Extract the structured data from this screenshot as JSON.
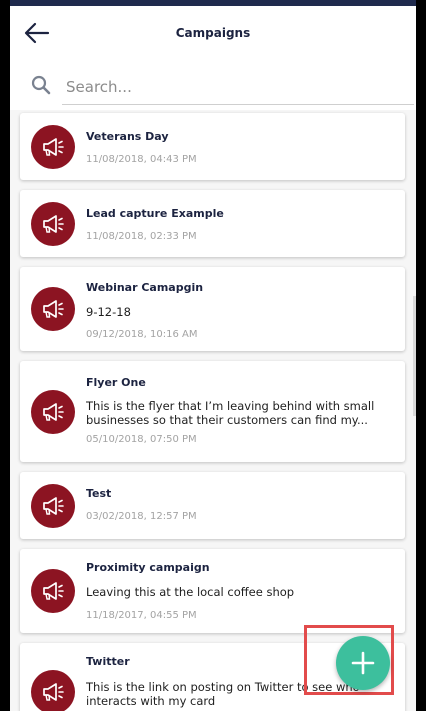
{
  "appbar": {
    "title": "Campaigns"
  },
  "search": {
    "placeholder": "Search..."
  },
  "campaigns": [
    {
      "name": "Veterans Day",
      "description": "",
      "date": "11/08/2018, 04:43 PM"
    },
    {
      "name": "Lead capture Example",
      "description": "",
      "date": "11/08/2018, 02:33 PM"
    },
    {
      "name": "Webinar Camapgin",
      "description": "9-12-18",
      "date": "09/12/2018, 10:16 AM"
    },
    {
      "name": "Flyer One",
      "description": "This is the flyer that I’m leaving behind with small businesses so that their customers can find my...",
      "date": "05/10/2018, 07:50 PM"
    },
    {
      "name": "Test",
      "description": "",
      "date": "03/02/2018, 12:57 PM"
    },
    {
      "name": "Proximity campaign",
      "description": "Leaving this at the local coffee shop",
      "date": "11/18/2017, 04:55 PM"
    },
    {
      "name": "Twitter",
      "description": "This is the link on posting on Twitter to see who interacts with my card",
      "date": ""
    }
  ],
  "icons": {
    "back": "arrow-left-icon",
    "search": "search-icon",
    "campaign": "megaphone-icon",
    "add": "plus-icon"
  },
  "colors": {
    "avatar": "#8c1422",
    "fab": "#3dbf9d",
    "highlight": "#e24b4b",
    "title": "#1c2340"
  }
}
